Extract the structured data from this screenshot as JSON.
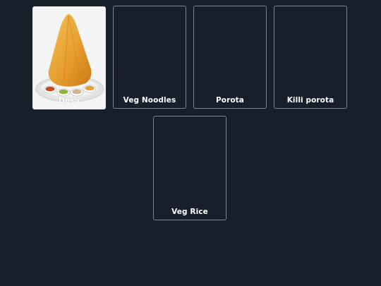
{
  "menu": {
    "items": [
      {
        "label": "Dosa",
        "image": "dosa-photo"
      },
      {
        "label": "Veg Noodles"
      },
      {
        "label": "Porota"
      },
      {
        "label": "Killi porota"
      },
      {
        "label": "Veg Rice"
      }
    ]
  },
  "colors": {
    "background": "#17202a",
    "card_border": "#7b8590",
    "label_text": "#ffffff"
  }
}
